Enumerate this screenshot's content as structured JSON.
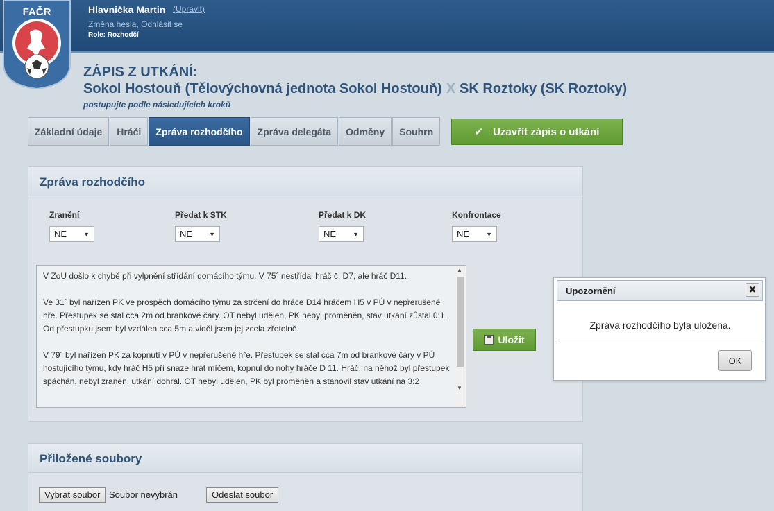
{
  "header": {
    "user_name": "Hlavnička Martin",
    "edit_link": "(Upravit)",
    "change_password": "Změna hesla",
    "separator": ",",
    "logout": "Odhlásit se",
    "role": "Role: Rozhodčí",
    "logo_text": "FAČR"
  },
  "page": {
    "title": "ZÁPIS Z UTKÁNÍ:",
    "home_team": "Sokol Hostouň (Tělovýchovná jednota Sokol Hostouň)",
    "versus": "X",
    "away_team": "SK Roztoky (SK Roztoky)",
    "subtitle": "postupujte podle následujících kroků"
  },
  "tabs": [
    {
      "label": "Základní údaje",
      "active": false
    },
    {
      "label": "Hráči",
      "active": false
    },
    {
      "label": "Zpráva rozhodčího",
      "active": true
    },
    {
      "label": "Zpráva delegáta",
      "active": false
    },
    {
      "label": "Odměny",
      "active": false
    },
    {
      "label": "Souhrn",
      "active": false
    }
  ],
  "close_button": "Uzavřít zápis o utkání",
  "report": {
    "heading": "Zpráva rozhodčího",
    "fields": [
      {
        "label": "Zranění",
        "value": "NE"
      },
      {
        "label": "Předat k STK",
        "value": "NE"
      },
      {
        "label": "Předat k DK",
        "value": "NE"
      },
      {
        "label": "Konfrontace",
        "value": "NE"
      }
    ],
    "text": [
      "V ZoU došlo k chybě při vylpnění střídání domácího týmu. V 75´ nestřídal hráč č. D7, ale hráč D11.",
      "Ve 31´ byl nařízen PK ve prospěch domácího týmu za strčení do hráče D14 hráčem H5 v PÚ v nepřerušené hře. Přestupek se stal cca 2m od brankové čáry. OT nebyl udělen, PK nebyl proměněn, stav utkání zůstal 0:1. Od přestupku jsem byl vzdálen cca 5m a viděl jsem jej zcela zřetelně.",
      "V 79´ byl nařízen PK za kopnutí v PÚ v nepřerušené hře. Přestupek se stal cca 7m od brankové čáry v PÚ hostujícího týmu, kdy hráč H5 při snaze hrát míčem, kopnul do nohy hráče D 11. Hráč, na něhož byl přestupek spáchán, nebyl zraněn, utkání dohrál. OT nebyl udělen, PK byl proměněn a stanovil stav utkání na 3:2"
    ],
    "save_button": "Uložit"
  },
  "attachments": {
    "heading": "Přiložené soubory",
    "choose_button": "Vybrat soubor",
    "no_file": "Soubor nevybrán",
    "send_button": "Odeslat soubor"
  },
  "dialog": {
    "title": "Upozornění",
    "message": "Zpráva rozhodčího byla uložena.",
    "ok_button": "OK"
  },
  "colors": {
    "header_blue": "#2f5b8a",
    "title_blue": "#2f5379",
    "green": "#6aa63c",
    "active_tab": "#3b6aa0"
  }
}
